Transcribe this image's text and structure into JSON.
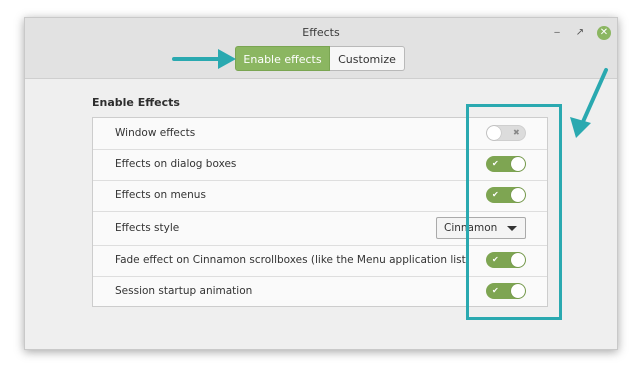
{
  "window": {
    "title": "Effects"
  },
  "tabs": [
    {
      "label": "Enable effects",
      "active": true
    },
    {
      "label": "Customize",
      "active": false
    }
  ],
  "section": {
    "title": "Enable Effects"
  },
  "settings": [
    {
      "label": "Window effects",
      "control": "toggle",
      "enabled": false
    },
    {
      "label": "Effects on dialog boxes",
      "control": "toggle",
      "enabled": true
    },
    {
      "label": "Effects on menus",
      "control": "toggle",
      "enabled": true
    },
    {
      "label": "Effects style",
      "control": "select",
      "value": "Cinnamon"
    },
    {
      "label": "Fade effect on Cinnamon scrollboxes (like the Menu application list)",
      "control": "toggle",
      "enabled": true
    },
    {
      "label": "Session startup animation",
      "control": "toggle",
      "enabled": true
    }
  ],
  "colors": {
    "accent": "#8bb661",
    "annotation": "#2aa9b0"
  },
  "icons": {
    "minimize": "minimize-icon",
    "maximize": "maximize-icon",
    "close": "close-icon"
  }
}
